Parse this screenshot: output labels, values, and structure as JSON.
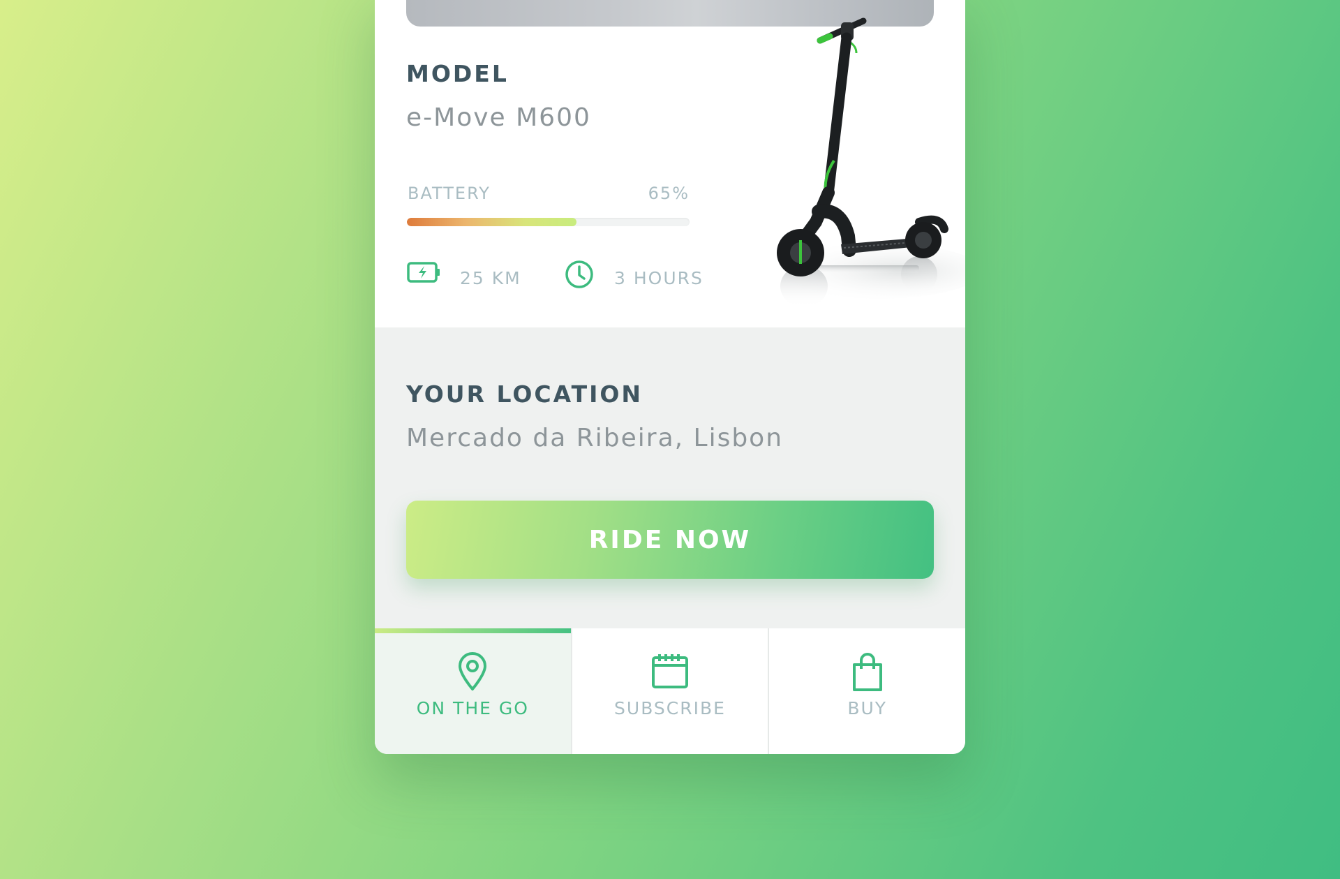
{
  "model": {
    "heading": "MODEL",
    "name": "e-Move M600"
  },
  "battery": {
    "label": "BATTERY",
    "percent_text": "65%",
    "level": 0.6
  },
  "stats": {
    "range": "25 KM",
    "duration": "3 HOURS"
  },
  "location": {
    "heading": "YOUR LOCATION",
    "value": "Mercado da Ribeira, Lisbon"
  },
  "cta": {
    "label": "RIDE NOW"
  },
  "tabs": [
    {
      "label": "ON THE GO",
      "icon": "map-pin-icon",
      "active": true
    },
    {
      "label": "SUBSCRIBE",
      "icon": "calendar-icon",
      "active": false
    },
    {
      "label": "BUY",
      "icon": "shopping-bag-icon",
      "active": false
    }
  ],
  "colors": {
    "accent": "#3dbb7f",
    "heading": "#3f5560",
    "muted": "#a9bcc2"
  }
}
